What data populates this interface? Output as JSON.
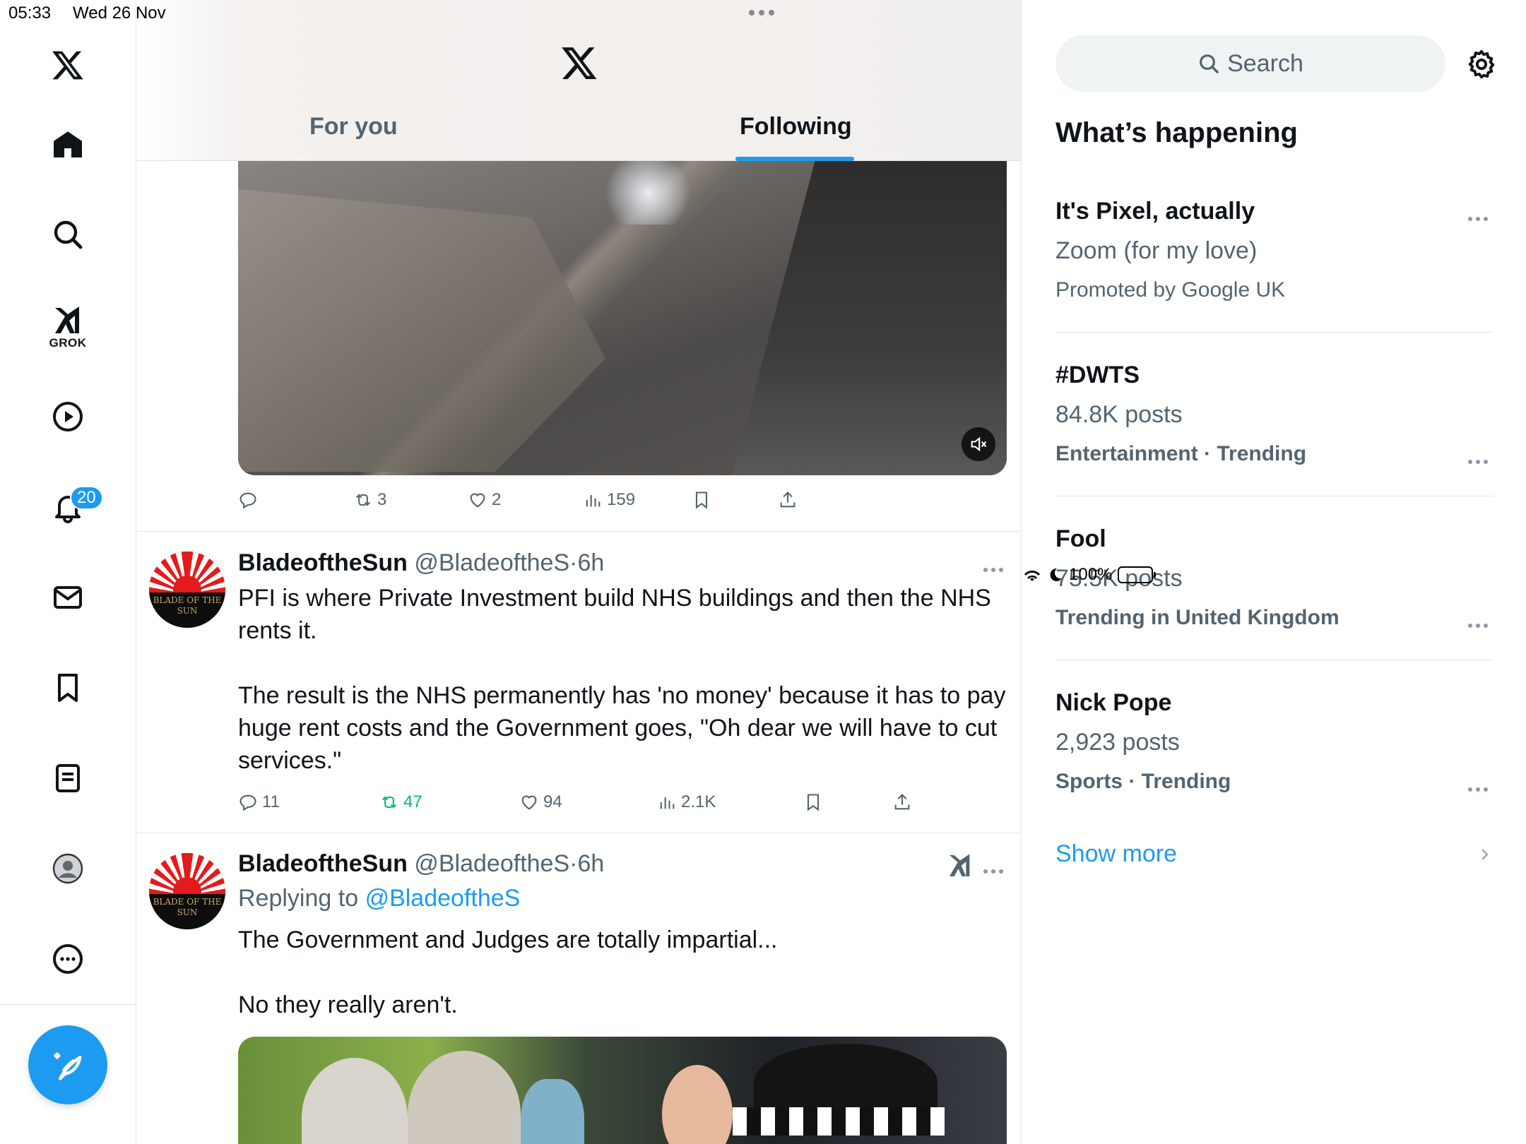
{
  "status": {
    "time": "05:33",
    "date": "Wed 26 Nov",
    "battery": "100%"
  },
  "nav": {
    "items": [
      "home",
      "explore",
      "grok",
      "videos",
      "notifications",
      "messages",
      "bookmarks",
      "lists",
      "profile",
      "more"
    ],
    "grok_label": "GROK",
    "notifications_badge": "20"
  },
  "header": {
    "tabs": [
      {
        "label": "For you",
        "active": false
      },
      {
        "label": "Following",
        "active": true
      }
    ]
  },
  "tweet1": {
    "replies": "",
    "reposts": "3",
    "likes": "2",
    "views": "159"
  },
  "tweet2": {
    "name": "BladeoftheSun",
    "handle": "@BladeoftheS",
    "time": "6h",
    "text": "PFI is where Private Investment build NHS buildings and then the NHS rents it.\n\nThe result is the NHS permanently has 'no money' because it has to pay huge rent costs and the Government goes, \"Oh dear we will have to cut services.\"",
    "replies": "11",
    "reposts": "47",
    "likes": "94",
    "views": "2.1K"
  },
  "tweet3": {
    "name": "BladeoftheSun",
    "handle": "@BladeoftheS",
    "time": "6h",
    "replying_prefix": "Replying to",
    "replying_to": "@BladeoftheS",
    "text": "The Government and Judges are totally impartial...\n\nNo they really aren't."
  },
  "avatar_text": "BLADE OF THE SUN",
  "search": {
    "placeholder": "Search"
  },
  "whats_happening": {
    "title": "What’s happening",
    "trends": [
      {
        "title": "It's Pixel, actually",
        "subtitle": "Zoom (for my love)",
        "meta": "Promoted by Google UK"
      },
      {
        "title": "#DWTS",
        "subtitle": "84.8K posts",
        "meta": "Entertainment · Trending"
      },
      {
        "title": "Fool",
        "subtitle": "75.5K posts",
        "meta": "Trending in United Kingdom"
      },
      {
        "title": "Nick Pope",
        "subtitle": "2,923 posts",
        "meta": "Sports · Trending"
      }
    ],
    "show_more": "Show more"
  },
  "colors": {
    "accent": "#1d9bf0",
    "repost_active": "#00ba7c",
    "text_primary": "#0f1419",
    "text_secondary": "#536471"
  }
}
